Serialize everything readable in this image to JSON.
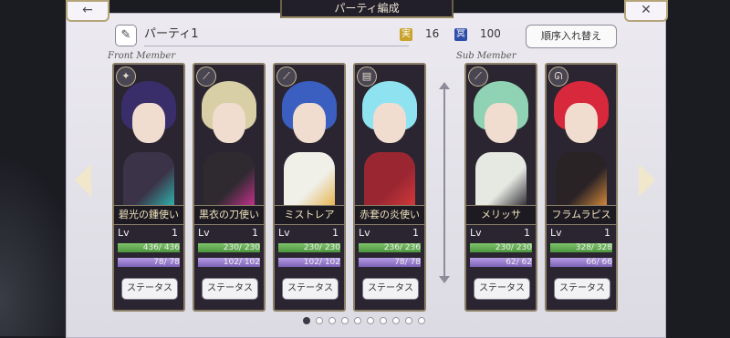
{
  "header": {
    "title": "パーティ編成",
    "back_icon": "back-arrow-icon",
    "back_label": "←",
    "close_icon": "close-icon",
    "close_label": "✕"
  },
  "party": {
    "edit_icon": "pencil-icon",
    "edit_glyph": "✎",
    "name": "パーティ1",
    "stat1_glyph": "実",
    "stat1_value": "16",
    "stat2_glyph": "冥",
    "stat2_value": "100",
    "reorder_label": "順序入れ替え"
  },
  "sections": {
    "front": "Front Member",
    "sub": "Sub Member"
  },
  "status_label": "ステータス",
  "lv_label": "Lv",
  "members": [
    {
      "name": "碧光の鍾使い",
      "lv": "1",
      "hp": "436/ 436",
      "mp": "78/ 78",
      "hair": "#3a2e6a",
      "outfit": "#3b3448",
      "accent": "#2fb6b0",
      "weapon": "✦"
    },
    {
      "name": "黒衣の刀使い",
      "lv": "1",
      "hp": "230/ 230",
      "mp": "102/ 102",
      "hair": "#d9cfa6",
      "outfit": "#2e2a30",
      "accent": "#c9318e",
      "weapon": "⟋"
    },
    {
      "name": "ミストレア",
      "lv": "1",
      "hp": "230/ 230",
      "mp": "102/ 102",
      "hair": "#3b5fc0",
      "outfit": "#f0efe8",
      "accent": "#e6b34c",
      "weapon": "⟋"
    },
    {
      "name": "赤套の炎使い",
      "lv": "1",
      "hp": "236/ 236",
      "mp": "78/ 78",
      "hair": "#8fe3f0",
      "outfit": "#9a2632",
      "accent": "#d23a3a",
      "weapon": "▤"
    },
    {
      "name": "メリッサ",
      "lv": "1",
      "hp": "230/ 230",
      "mp": "62/ 62",
      "hair": "#8fd3b4",
      "outfit": "#e6e8e2",
      "accent": "#2d2a30",
      "weapon": "⟋"
    },
    {
      "name": "フラムラピス",
      "lv": "1",
      "hp": "328/ 328",
      "mp": "66/ 66",
      "hair": "#d8283b",
      "outfit": "#2a2326",
      "accent": "#d98a3a",
      "weapon": "ᘏ"
    }
  ],
  "colors": {
    "stat1": "#c8a22a",
    "stat2": "#2f4da8"
  },
  "pager": {
    "pages": 10,
    "current": 1
  }
}
